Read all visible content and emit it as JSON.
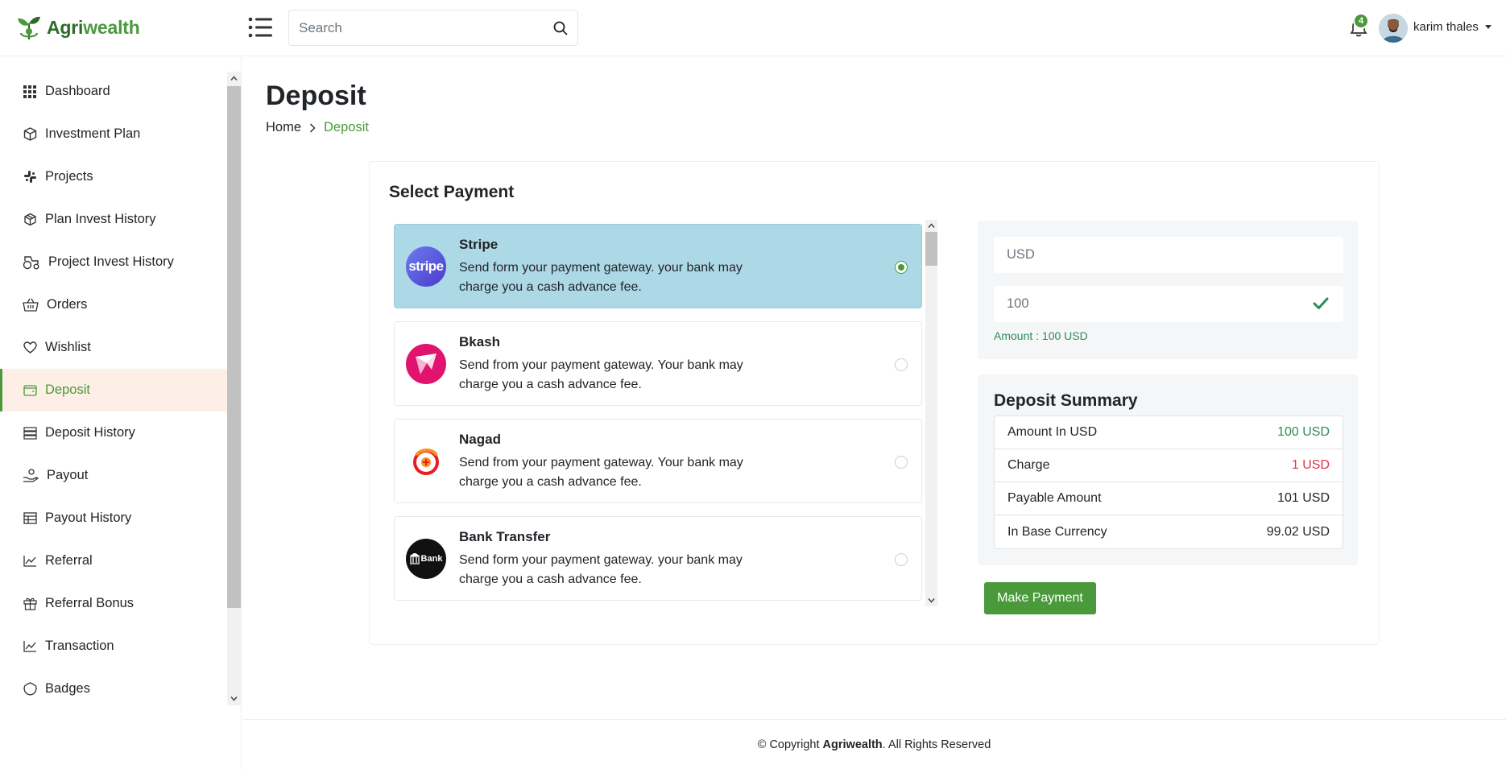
{
  "brand": {
    "name_part1": "Agri",
    "name_part2": "wealth",
    "color": "#4a9a3c"
  },
  "search": {
    "placeholder": "Search"
  },
  "notifications": {
    "count": "4"
  },
  "user": {
    "name": "karim thales"
  },
  "sidebar": {
    "items": [
      {
        "label": "Dashboard",
        "icon": "grid-icon"
      },
      {
        "label": "Investment Plan",
        "icon": "cube-icon"
      },
      {
        "label": "Projects",
        "icon": "slack-icon"
      },
      {
        "label": "Plan Invest History",
        "icon": "box-icon"
      },
      {
        "label": "Project Invest History",
        "icon": "tractor-icon"
      },
      {
        "label": "Orders",
        "icon": "basket-icon"
      },
      {
        "label": "Wishlist",
        "icon": "heart-icon"
      },
      {
        "label": "Deposit",
        "icon": "wallet-icon",
        "active": true
      },
      {
        "label": "Deposit History",
        "icon": "server-icon"
      },
      {
        "label": "Payout",
        "icon": "hand-coin-icon"
      },
      {
        "label": "Payout History",
        "icon": "table-icon"
      },
      {
        "label": "Referral",
        "icon": "chart-line-icon"
      },
      {
        "label": "Referral Bonus",
        "icon": "gift-icon"
      },
      {
        "label": "Transaction",
        "icon": "chart-line-icon"
      },
      {
        "label": "Badges",
        "icon": "badge-icon"
      }
    ]
  },
  "page": {
    "title": "Deposit",
    "breadcrumb": {
      "home": "Home",
      "current": "Deposit"
    }
  },
  "payment": {
    "title": "Select Payment",
    "methods": [
      {
        "name": "Stripe",
        "logo_text": "stripe",
        "desc": "Send form your payment gateway. your bank may charge you a cash advance fee.",
        "selected": true
      },
      {
        "name": "Bkash",
        "logo_text": "",
        "desc": "Send from your payment gateway. Your bank may charge you a cash advance fee.",
        "selected": false
      },
      {
        "name": "Nagad",
        "logo_text": "",
        "desc": "Send from your payment gateway. Your bank may charge you a cash advance fee.",
        "selected": false
      },
      {
        "name": "Bank Transfer",
        "logo_text": "Bank",
        "desc": "Send form your payment gateway. your bank may charge you a cash advance fee.",
        "selected": false
      }
    ]
  },
  "amount": {
    "currency_value": "USD",
    "amount_value": "100",
    "note": "Amount : 100 USD"
  },
  "summary": {
    "title": "Deposit Summary",
    "rows": [
      {
        "label": "Amount In USD",
        "value": "100 USD",
        "tone": "green"
      },
      {
        "label": "Charge",
        "value": "1 USD",
        "tone": "red"
      },
      {
        "label": "Payable Amount",
        "value": "101 USD",
        "tone": "normal"
      },
      {
        "label": "In Base Currency",
        "value": "99.02 USD",
        "tone": "normal"
      }
    ]
  },
  "actions": {
    "make_payment": "Make Payment"
  },
  "footer": {
    "prefix": "© Copyright ",
    "brand": "Agriwealth",
    "suffix": ". All Rights Reserved"
  }
}
